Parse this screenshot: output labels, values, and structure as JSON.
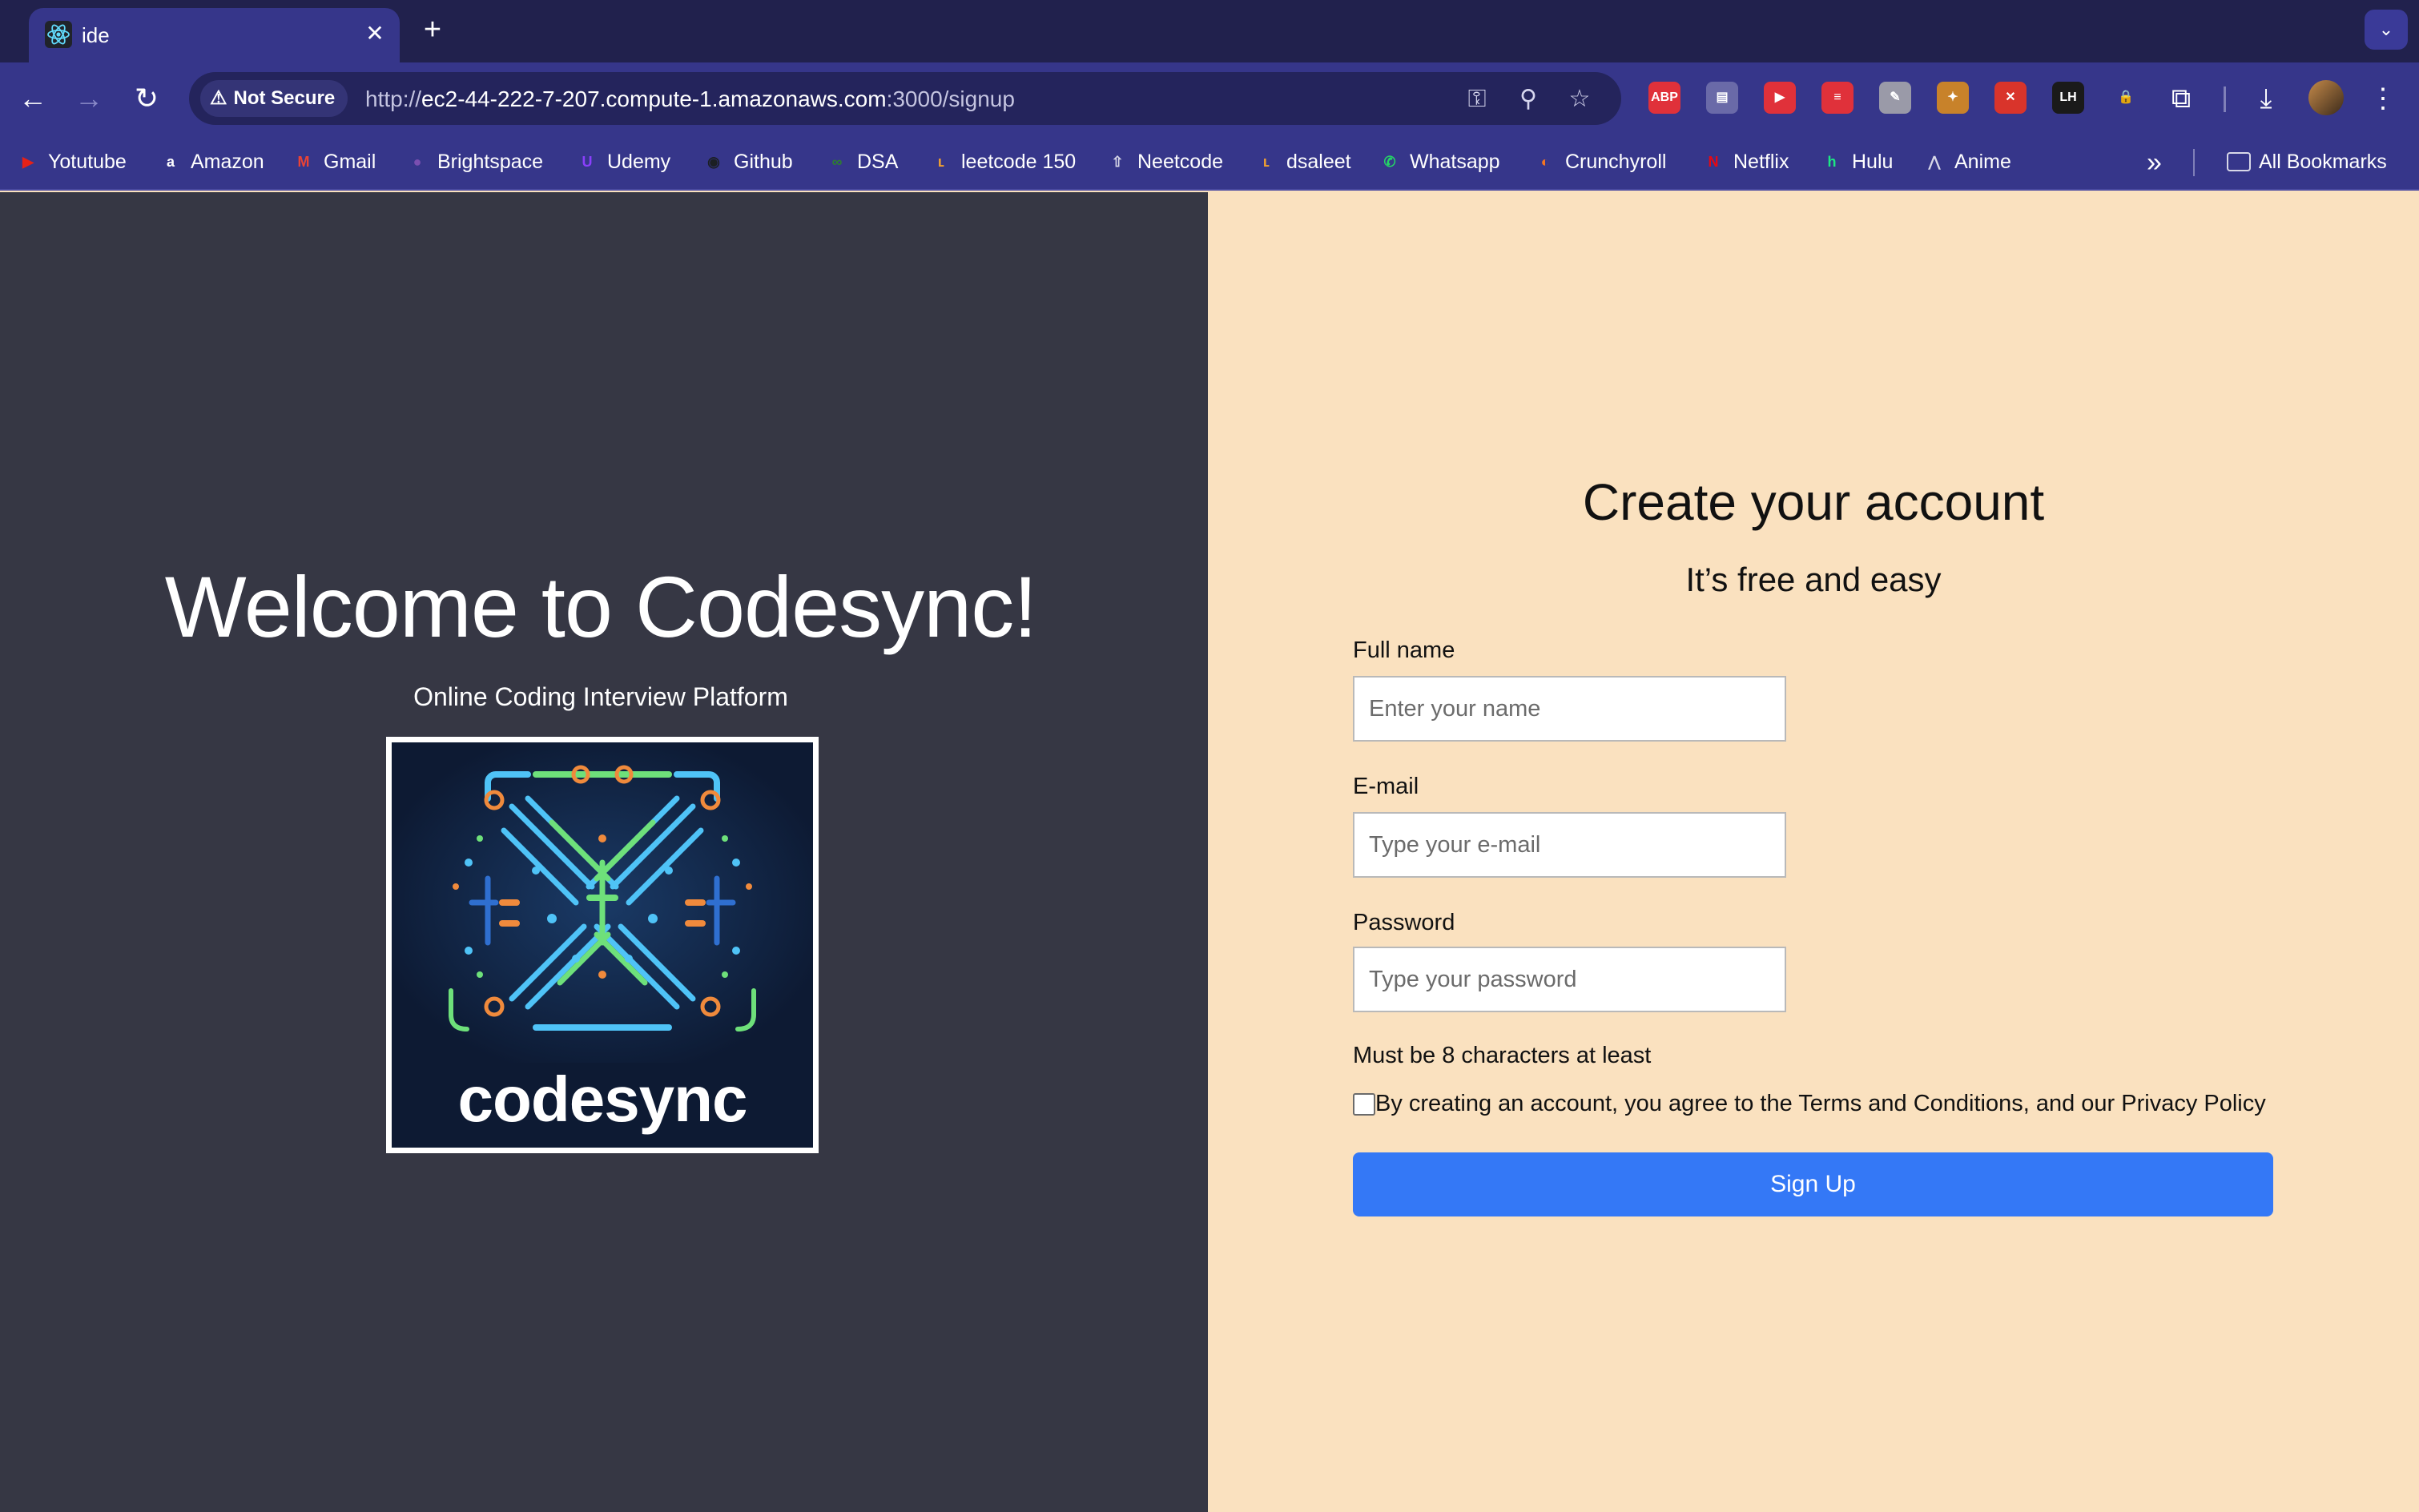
{
  "browser": {
    "tab": {
      "title": "ide",
      "favicon": "react-atom-icon"
    },
    "security_label": "Not Secure",
    "url": {
      "scheme": "http://",
      "host": "ec2-44-222-7-207.compute-1.amazonaws.com",
      "rest": ":3000/signup"
    },
    "extensions": [
      {
        "name": "adblock-plus",
        "text": "ABP",
        "color": "#e0313a"
      },
      {
        "name": "tab-manager",
        "text": "▤",
        "color": "#6a6aa8"
      },
      {
        "name": "youtube-ext",
        "text": "▶",
        "color": "#e0313a"
      },
      {
        "name": "stop-ext",
        "text": "≡",
        "color": "#e0313a"
      },
      {
        "name": "pen-ext",
        "text": "✎",
        "color": "#9a9aa8"
      },
      {
        "name": "note-ext",
        "text": "✦",
        "color": "#c8822a"
      },
      {
        "name": "wand-ext",
        "text": "✕",
        "color": "#d9342b"
      },
      {
        "name": "lh-ext",
        "text": "LH",
        "color": "#1a1a1a"
      },
      {
        "name": "lock-ext",
        "text": "🔒",
        "color": "#36368a"
      }
    ]
  },
  "bookmarks": [
    {
      "label": "Yotutube",
      "icon": "youtube-icon",
      "glyph": "▶",
      "color": "#e62117"
    },
    {
      "label": "Amazon",
      "icon": "amazon-icon",
      "glyph": "a",
      "color": "#ffffff"
    },
    {
      "label": "Gmail",
      "icon": "gmail-icon",
      "glyph": "M",
      "color": "#ea4335"
    },
    {
      "label": "Brightspace",
      "icon": "brightspace-icon",
      "glyph": "●",
      "color": "#7a4fb0"
    },
    {
      "label": "Udemy",
      "icon": "udemy-icon",
      "glyph": "U",
      "color": "#8a3ffc"
    },
    {
      "label": "Github",
      "icon": "github-icon",
      "glyph": "◉",
      "color": "#1b1f23"
    },
    {
      "label": "DSA",
      "icon": "dsa-icon",
      "glyph": "∞",
      "color": "#2e7d32"
    },
    {
      "label": "leetcode 150",
      "icon": "leetcode-icon",
      "glyph": "ʟ",
      "color": "#f0a030"
    },
    {
      "label": "Neetcode",
      "icon": "rocket-icon",
      "glyph": "⇧",
      "color": "#d8d8e8"
    },
    {
      "label": "dsaleet",
      "icon": "leetcode-icon",
      "glyph": "ʟ",
      "color": "#f0a030"
    },
    {
      "label": "Whatsapp",
      "icon": "whatsapp-icon",
      "glyph": "✆",
      "color": "#25d366"
    },
    {
      "label": "Crunchyroll",
      "icon": "crunchyroll-icon",
      "glyph": "◐",
      "color": "#f47521"
    },
    {
      "label": "Netflix",
      "icon": "netflix-icon",
      "glyph": "N",
      "color": "#e50914"
    },
    {
      "label": "Hulu",
      "icon": "hulu-icon",
      "glyph": "h",
      "color": "#1ce783"
    },
    {
      "label": "Anime",
      "icon": "anime-icon",
      "glyph": "⋀",
      "color": "#d8d8e8"
    }
  ],
  "all_bookmarks_label": "All Bookmarks",
  "left": {
    "title": "Welcome to Codesync!",
    "subtitle": "Online Coding Interview Platform",
    "logo_word": "codesync"
  },
  "form": {
    "heading": "Create your account",
    "tagline": "It’s free and easy",
    "name_label": "Full name",
    "name_placeholder": "Enter your name",
    "name_value": "",
    "email_label": "E-mail",
    "email_placeholder": "Type your e-mail",
    "email_value": "",
    "password_label": "Password",
    "password_placeholder": "Type your password",
    "password_value": "",
    "password_hint": "Must be 8 characters at least",
    "terms_text": "By creating an account, you agree to the Terms and Conditions, and our Privacy Policy",
    "terms_checked": false,
    "submit_label": "Sign Up"
  },
  "colors": {
    "left_bg": "#363744",
    "right_bg": "#fae1bf",
    "button": "#3478f6",
    "chrome": "#36368a"
  }
}
